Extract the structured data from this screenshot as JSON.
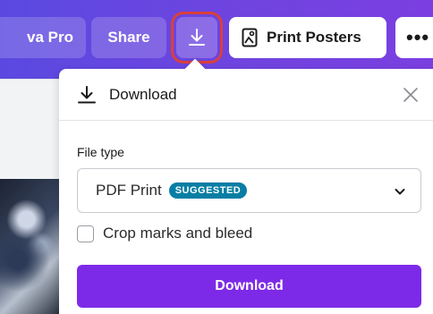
{
  "toolbar": {
    "pro_label": "va Pro",
    "share_label": "Share",
    "download_icon": "download-icon",
    "print_label": "Print Posters",
    "print_icon": "poster-icon",
    "more_label": "•••"
  },
  "panel": {
    "title": "Download",
    "file_type_label": "File type",
    "file_type_value": "PDF Print",
    "file_type_badge": "SUGGESTED",
    "crop_marks_label": "Crop marks and bleed",
    "crop_marks_checked": false,
    "download_button_label": "Download"
  },
  "colors": {
    "toolbar_gradient_start": "#5a49e0",
    "toolbar_gradient_end": "#7b3fe0",
    "primary_button": "#7d2ae8",
    "badge": "#087ea4",
    "highlight_outline": "#d9403b"
  }
}
